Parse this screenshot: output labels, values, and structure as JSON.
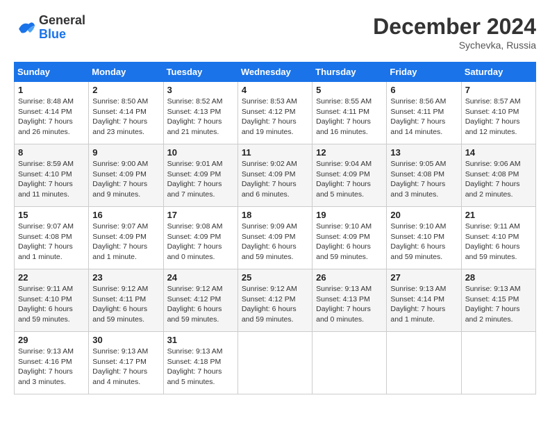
{
  "header": {
    "logo_line1": "General",
    "logo_line2": "Blue",
    "month_title": "December 2024",
    "location": "Sychevka, Russia"
  },
  "weekdays": [
    "Sunday",
    "Monday",
    "Tuesday",
    "Wednesday",
    "Thursday",
    "Friday",
    "Saturday"
  ],
  "weeks": [
    [
      {
        "day": "1",
        "sunrise": "8:48 AM",
        "sunset": "4:14 PM",
        "daylight": "7 hours and 26 minutes."
      },
      {
        "day": "2",
        "sunrise": "8:50 AM",
        "sunset": "4:14 PM",
        "daylight": "7 hours and 23 minutes."
      },
      {
        "day": "3",
        "sunrise": "8:52 AM",
        "sunset": "4:13 PM",
        "daylight": "7 hours and 21 minutes."
      },
      {
        "day": "4",
        "sunrise": "8:53 AM",
        "sunset": "4:12 PM",
        "daylight": "7 hours and 19 minutes."
      },
      {
        "day": "5",
        "sunrise": "8:55 AM",
        "sunset": "4:11 PM",
        "daylight": "7 hours and 16 minutes."
      },
      {
        "day": "6",
        "sunrise": "8:56 AM",
        "sunset": "4:11 PM",
        "daylight": "7 hours and 14 minutes."
      },
      {
        "day": "7",
        "sunrise": "8:57 AM",
        "sunset": "4:10 PM",
        "daylight": "7 hours and 12 minutes."
      }
    ],
    [
      {
        "day": "8",
        "sunrise": "8:59 AM",
        "sunset": "4:10 PM",
        "daylight": "7 hours and 11 minutes."
      },
      {
        "day": "9",
        "sunrise": "9:00 AM",
        "sunset": "4:09 PM",
        "daylight": "7 hours and 9 minutes."
      },
      {
        "day": "10",
        "sunrise": "9:01 AM",
        "sunset": "4:09 PM",
        "daylight": "7 hours and 7 minutes."
      },
      {
        "day": "11",
        "sunrise": "9:02 AM",
        "sunset": "4:09 PM",
        "daylight": "7 hours and 6 minutes."
      },
      {
        "day": "12",
        "sunrise": "9:04 AM",
        "sunset": "4:09 PM",
        "daylight": "7 hours and 5 minutes."
      },
      {
        "day": "13",
        "sunrise": "9:05 AM",
        "sunset": "4:08 PM",
        "daylight": "7 hours and 3 minutes."
      },
      {
        "day": "14",
        "sunrise": "9:06 AM",
        "sunset": "4:08 PM",
        "daylight": "7 hours and 2 minutes."
      }
    ],
    [
      {
        "day": "15",
        "sunrise": "9:07 AM",
        "sunset": "4:08 PM",
        "daylight": "7 hours and 1 minute."
      },
      {
        "day": "16",
        "sunrise": "9:07 AM",
        "sunset": "4:09 PM",
        "daylight": "7 hours and 1 minute."
      },
      {
        "day": "17",
        "sunrise": "9:08 AM",
        "sunset": "4:09 PM",
        "daylight": "7 hours and 0 minutes."
      },
      {
        "day": "18",
        "sunrise": "9:09 AM",
        "sunset": "4:09 PM",
        "daylight": "6 hours and 59 minutes."
      },
      {
        "day": "19",
        "sunrise": "9:10 AM",
        "sunset": "4:09 PM",
        "daylight": "6 hours and 59 minutes."
      },
      {
        "day": "20",
        "sunrise": "9:10 AM",
        "sunset": "4:10 PM",
        "daylight": "6 hours and 59 minutes."
      },
      {
        "day": "21",
        "sunrise": "9:11 AM",
        "sunset": "4:10 PM",
        "daylight": "6 hours and 59 minutes."
      }
    ],
    [
      {
        "day": "22",
        "sunrise": "9:11 AM",
        "sunset": "4:10 PM",
        "daylight": "6 hours and 59 minutes."
      },
      {
        "day": "23",
        "sunrise": "9:12 AM",
        "sunset": "4:11 PM",
        "daylight": "6 hours and 59 minutes."
      },
      {
        "day": "24",
        "sunrise": "9:12 AM",
        "sunset": "4:12 PM",
        "daylight": "6 hours and 59 minutes."
      },
      {
        "day": "25",
        "sunrise": "9:12 AM",
        "sunset": "4:12 PM",
        "daylight": "6 hours and 59 minutes."
      },
      {
        "day": "26",
        "sunrise": "9:13 AM",
        "sunset": "4:13 PM",
        "daylight": "7 hours and 0 minutes."
      },
      {
        "day": "27",
        "sunrise": "9:13 AM",
        "sunset": "4:14 PM",
        "daylight": "7 hours and 1 minute."
      },
      {
        "day": "28",
        "sunrise": "9:13 AM",
        "sunset": "4:15 PM",
        "daylight": "7 hours and 2 minutes."
      }
    ],
    [
      {
        "day": "29",
        "sunrise": "9:13 AM",
        "sunset": "4:16 PM",
        "daylight": "7 hours and 3 minutes."
      },
      {
        "day": "30",
        "sunrise": "9:13 AM",
        "sunset": "4:17 PM",
        "daylight": "7 hours and 4 minutes."
      },
      {
        "day": "31",
        "sunrise": "9:13 AM",
        "sunset": "4:18 PM",
        "daylight": "7 hours and 5 minutes."
      },
      null,
      null,
      null,
      null
    ]
  ]
}
